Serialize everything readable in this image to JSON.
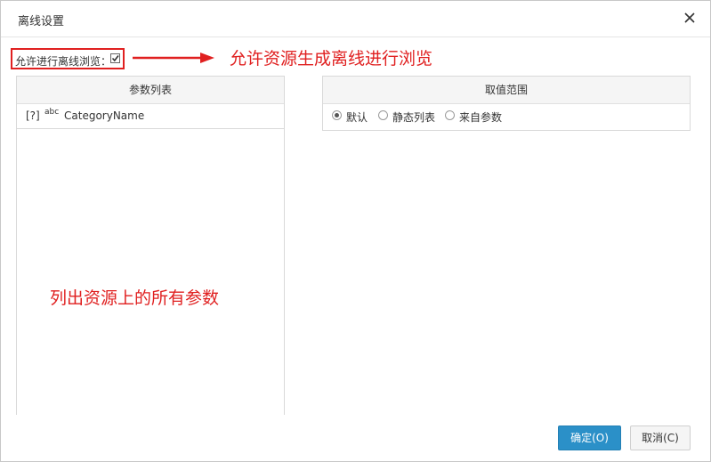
{
  "dialog": {
    "title": "离线设置",
    "close_icon": "close-icon"
  },
  "offline": {
    "label": "允许进行离线浏览：",
    "checked": true
  },
  "annotations": {
    "top": "允许资源生成离线进行浏览",
    "left_panel": "列出资源上的所有参数",
    "color": "#e02020"
  },
  "param_list": {
    "header": "参数列表",
    "items": [
      {
        "icon_text": "[?]",
        "type_text": "abc",
        "name": "CategoryName"
      }
    ]
  },
  "value_range": {
    "header": "取值范围",
    "options": [
      {
        "label": "默认",
        "selected": true
      },
      {
        "label": "静态列表",
        "selected": false
      },
      {
        "label": "来自参数",
        "selected": false
      }
    ]
  },
  "buttons": {
    "ok": "确定(O)",
    "cancel": "取消(C)",
    "ok_color": "#2b90c8"
  }
}
